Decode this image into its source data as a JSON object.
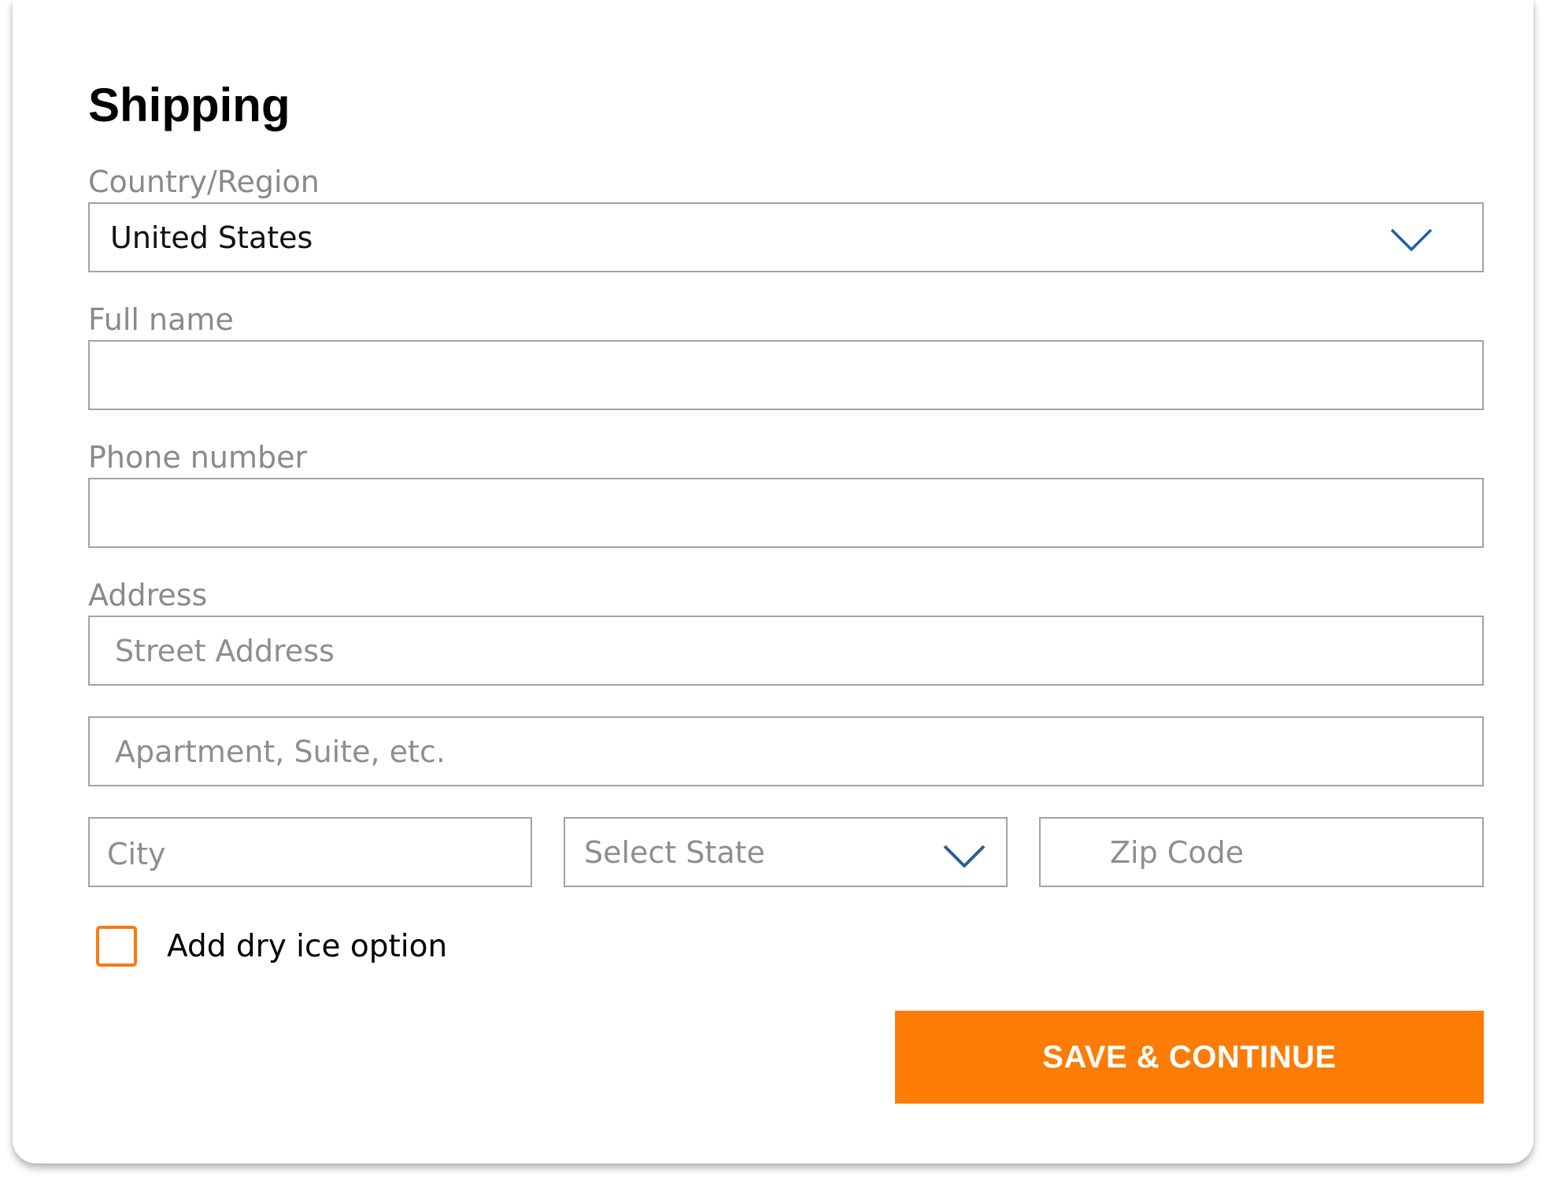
{
  "form": {
    "title": "Shipping",
    "country": {
      "label": "Country/Region",
      "value": "United States"
    },
    "full_name": {
      "label": "Full name",
      "value": ""
    },
    "phone": {
      "label": "Phone number",
      "value": ""
    },
    "address": {
      "label": "Address",
      "street_placeholder": "Street Address",
      "apartment_placeholder": "Apartment, Suite, etc.",
      "city_placeholder": "City",
      "state_placeholder": "Select State",
      "zip_placeholder": "Zip Code"
    },
    "dry_ice": {
      "label": "Add dry ice option",
      "checked": false
    },
    "submit_label": "SAVE & CONTINUE"
  },
  "icons": {
    "country_dropdown": "chevron-down-icon",
    "state_dropdown": "chevron-down-icon"
  },
  "colors": {
    "accent": "#fc7c05",
    "checkbox_border": "#f77b0f",
    "chevron_country": "#1f5fa8",
    "chevron_state": "#2a5d9a",
    "field_border": "#a3a3a3",
    "label_text": "#8a8a8a"
  }
}
